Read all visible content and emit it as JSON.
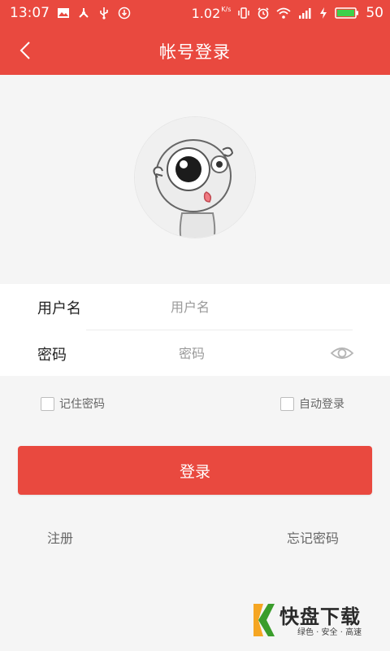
{
  "status_bar": {
    "time": "13:07",
    "speed": "1.02",
    "speed_unit": "K/s",
    "battery": "50",
    "icons": [
      "image-icon",
      "usb-tethering-icon",
      "usb-icon",
      "download-icon",
      "vibrate-icon",
      "alarm-icon",
      "wifi-icon",
      "signal-4g-icon",
      "charging-icon",
      "battery-icon"
    ]
  },
  "header": {
    "title": "帐号登录",
    "back_icon": "chevron-left-icon"
  },
  "form": {
    "username_label": "用户名",
    "username_placeholder": "用户名",
    "password_label": "密码",
    "password_placeholder": "密码",
    "eye_icon": "eye-icon"
  },
  "options": {
    "remember_label": "记住密码",
    "auto_login_label": "自动登录"
  },
  "login_button": "登录",
  "links": {
    "register": "注册",
    "forgot_password": "忘记密码"
  },
  "watermark": {
    "name": "快盘下载",
    "tagline": "绿色 · 安全 · 高速"
  },
  "colors": {
    "brand": "#e9493f",
    "background": "#f5f5f5"
  }
}
